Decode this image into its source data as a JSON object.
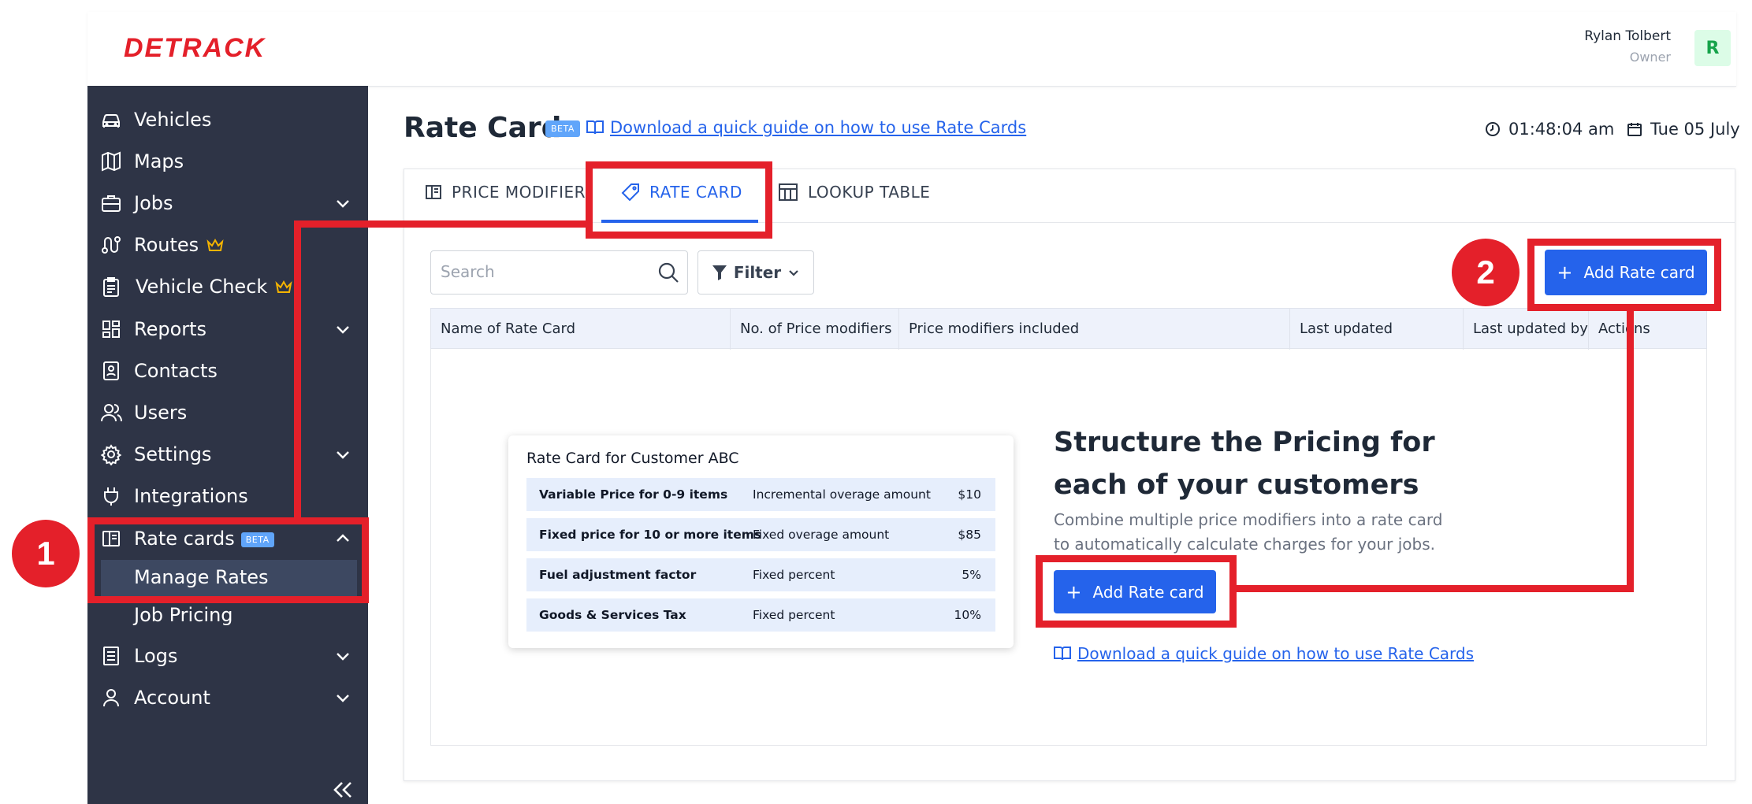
{
  "brand": {
    "logo_text": "DETRACK",
    "brand_color": "#e4202a",
    "accent_color": "#2563eb"
  },
  "user": {
    "name": "Rylan Tolbert",
    "role": "Owner",
    "avatar_letter": "R"
  },
  "sidebar": {
    "items": [
      {
        "label": "Vehicles",
        "icon": "car-icon"
      },
      {
        "label": "Maps",
        "icon": "map-icon"
      },
      {
        "label": "Jobs",
        "icon": "briefcase-icon",
        "expandable": true
      },
      {
        "label": "Routes",
        "icon": "route-icon",
        "premium": true
      },
      {
        "label": "Vehicle Check",
        "icon": "clipboard-icon",
        "premium": true
      },
      {
        "label": "Reports",
        "icon": "dashboard-icon",
        "expandable": true
      },
      {
        "label": "Contacts",
        "icon": "contact-card-icon"
      },
      {
        "label": "Users",
        "icon": "users-icon"
      },
      {
        "label": "Settings",
        "icon": "gear-icon",
        "expandable": true
      },
      {
        "label": "Integrations",
        "icon": "plug-icon"
      },
      {
        "label": "Rate cards",
        "icon": "rate-card-icon",
        "badge": "BETA",
        "expanded": true
      },
      {
        "label": "Manage Rates",
        "sub": true,
        "active": true
      },
      {
        "label": "Job Pricing",
        "sub": true
      },
      {
        "label": "Logs",
        "icon": "log-icon",
        "expandable": true
      },
      {
        "label": "Account",
        "icon": "user-icon",
        "expandable": true
      }
    ]
  },
  "header": {
    "title": "Rate Card",
    "badge": "BETA",
    "guide_link": "Download a quick guide on how to use Rate Cards",
    "time": "01:48:04 am",
    "date": "Tue 05 July"
  },
  "tabs": [
    {
      "label": "PRICE MODIFIER",
      "icon": "price-modifier-icon"
    },
    {
      "label": "RATE CARD",
      "icon": "tag-icon",
      "active": true
    },
    {
      "label": "LOOKUP TABLE",
      "icon": "table-icon"
    }
  ],
  "toolbar": {
    "search_placeholder": "Search",
    "filter_label": "Filter",
    "add_button": "Add Rate card"
  },
  "table": {
    "columns": [
      "Name of Rate Card",
      "No. of Price modifiers",
      "Price modifiers included",
      "Last updated",
      "Last updated by",
      "Actions"
    ]
  },
  "empty_state": {
    "card_title": "Rate Card for Customer ABC",
    "card_rows": [
      {
        "name": "Variable Price for 0-9 items",
        "type": "Incremental overage amount",
        "value": "$10"
      },
      {
        "name": "Fixed price for 10 or more items",
        "type": "Fixed overage amount",
        "value": "$85"
      },
      {
        "name": "Fuel adjustment factor",
        "type": "Fixed percent",
        "value": "5%"
      },
      {
        "name": "Goods & Services Tax",
        "type": "Fixed percent",
        "value": "10%"
      }
    ],
    "heading_line1": "Structure the Pricing for",
    "heading_line2": "each of your customers",
    "desc_line1": "Combine multiple price modifiers into a rate card",
    "desc_line2": "to automatically calculate charges for your jobs.",
    "add_button": "Add Rate card",
    "guide_link": "Download a quick guide on how to use Rate Cards"
  },
  "annotations": {
    "step1": "1",
    "step2": "2",
    "color": "#e4202a"
  }
}
